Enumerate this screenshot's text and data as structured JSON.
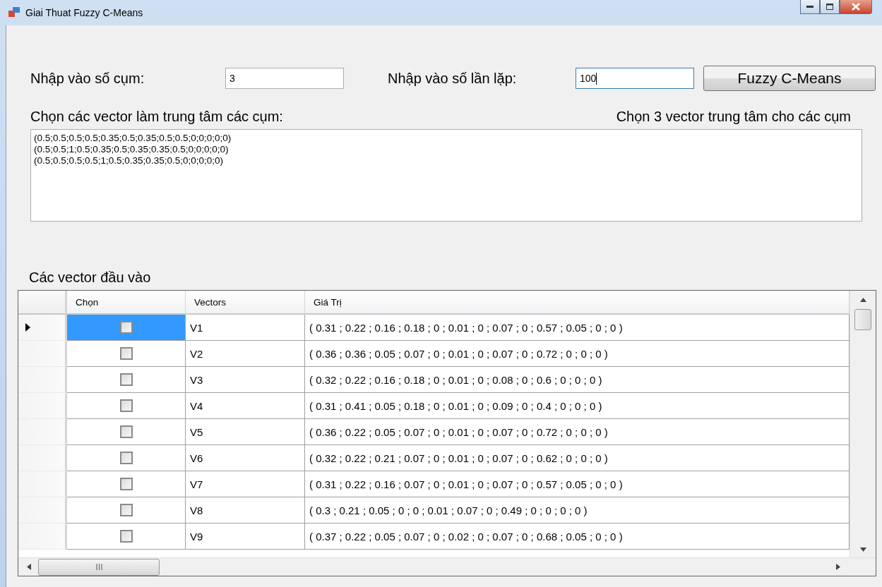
{
  "window": {
    "title": "Giai Thuat Fuzzy C-Means"
  },
  "cluster_count": {
    "label": "Nhập vào số cụm:",
    "value": "3"
  },
  "iterations": {
    "label": "Nhập vào số lần lặp:",
    "value": "100",
    "focused": true
  },
  "run_button": {
    "label": "Fuzzy C-Means"
  },
  "centers": {
    "label": "Chọn các vector làm trung tâm các cụm:",
    "hint": "Chọn 3 vector trung tâm cho các cụm",
    "lines": [
      "(0.5;0.5;0.5;0.5;0.35;0.5;0.35;0.5;0.5;0;0;0;0;0)",
      "(0.5;0.5;1;0.5;0.35;0.5;0.35;0.35;0.5;0;0;0;0;0)",
      "(0.5;0.5;0.5;0.5;1;0.5;0.35;0.35;0.5;0;0;0;0;0)"
    ]
  },
  "inputs": {
    "label": "Các vector đầu vào",
    "columns": [
      "Chọn",
      "Vectors",
      "Giá Trị"
    ],
    "rows": [
      {
        "selected": true,
        "checked": false,
        "vector": "V1",
        "value": "( 0.31 ; 0.22 ; 0.16 ; 0.18 ; 0 ; 0.01 ; 0 ; 0.07 ; 0 ; 0.57 ; 0.05 ; 0 ; 0 )"
      },
      {
        "selected": false,
        "checked": false,
        "vector": "V2",
        "value": "( 0.36 ; 0.36 ; 0.05 ; 0.07 ; 0 ; 0.01 ; 0 ; 0.07 ; 0 ; 0.72 ; 0 ; 0 ; 0 )"
      },
      {
        "selected": false,
        "checked": false,
        "vector": "V3",
        "value": "( 0.32 ; 0.22 ; 0.16 ; 0.18 ; 0 ; 0.01 ; 0 ; 0.08 ; 0 ; 0.6 ; 0 ; 0 ; 0 )"
      },
      {
        "selected": false,
        "checked": false,
        "vector": "V4",
        "value": "( 0.31 ; 0.41 ; 0.05 ; 0.18 ; 0 ; 0.01 ; 0 ; 0.09 ; 0 ; 0.4 ; 0 ; 0 ; 0 )"
      },
      {
        "selected": false,
        "checked": false,
        "vector": "V5",
        "value": "( 0.36 ; 0.22 ; 0.05 ; 0.07 ; 0 ; 0.01 ; 0 ; 0.07 ; 0 ; 0.72 ; 0 ; 0 ; 0 )"
      },
      {
        "selected": false,
        "checked": false,
        "vector": "V6",
        "value": "( 0.32 ; 0.22 ; 0.21 ; 0.07 ; 0 ; 0.01 ; 0 ; 0.07 ; 0 ; 0.62 ; 0 ; 0 ; 0 )"
      },
      {
        "selected": false,
        "checked": false,
        "vector": "V7",
        "value": "( 0.31 ; 0.22 ; 0.16 ; 0.07 ; 0 ; 0.01 ; 0 ; 0.07 ; 0 ; 0.57 ; 0.05 ; 0 ; 0 )"
      },
      {
        "selected": false,
        "checked": false,
        "vector": "V8",
        "value": "( 0.3 ; 0.21 ; 0.05 ; 0 ; 0 ; 0.01 ; 0.07 ; 0 ; 0.49 ; 0 ; 0 ; 0 ; 0 )"
      },
      {
        "selected": false,
        "checked": false,
        "vector": "V9",
        "value": "( 0.37 ; 0.22 ; 0.05 ; 0.07 ; 0 ; 0.02 ; 0 ; 0.07 ; 0 ; 0.68 ; 0.05 ; 0 ; 0 )"
      }
    ]
  }
}
